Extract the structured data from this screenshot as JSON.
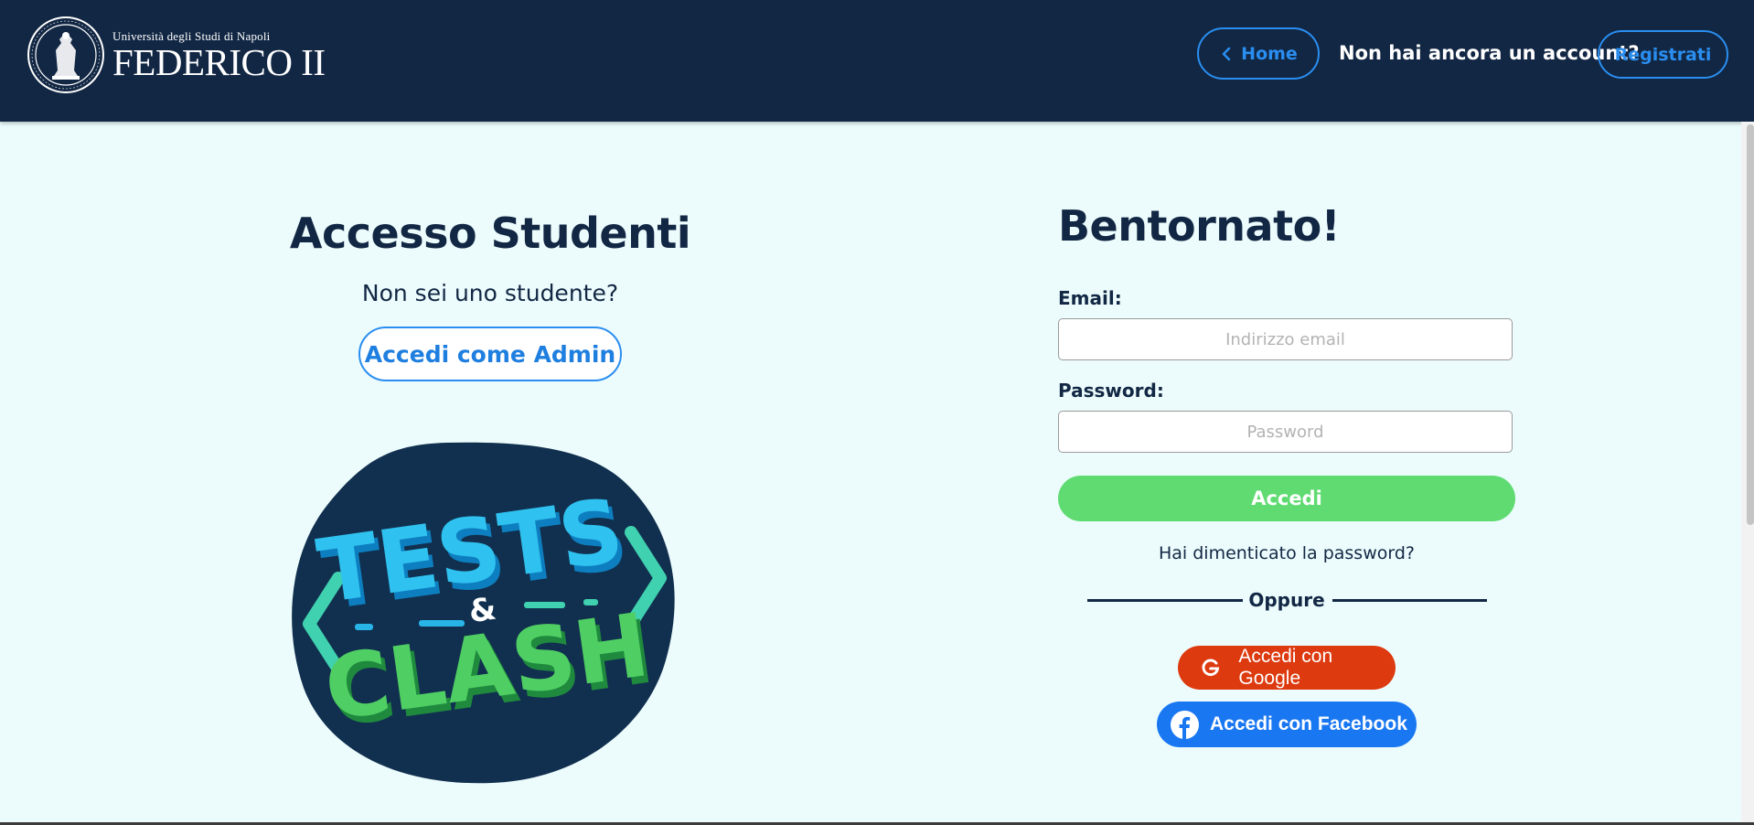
{
  "header": {
    "logo": {
      "line1": "Università degli Studi di Napoli",
      "line2": "FEDERICO II"
    },
    "home_label": "Home",
    "no_account_text": "Non hai ancora un account?",
    "register_label": "Registrati"
  },
  "left": {
    "title": "Accesso Studenti",
    "not_student_text": "Non sei uno studente?",
    "admin_button": "Accedi come Admin",
    "game_logo": {
      "word1": "TESTS",
      "amp": "&",
      "word2": "CLASH"
    }
  },
  "right": {
    "title": "Bentornato!",
    "email_label": "Email:",
    "email_placeholder": "Indirizzo email",
    "email_value": "",
    "password_label": "Password:",
    "password_placeholder": "Password",
    "password_value": "",
    "login_button": "Accedi",
    "forgot_password": "Hai dimenticato la password?",
    "or_text": "Oppure",
    "google_button": "Accedi con Google",
    "facebook_button": "Accedi con Facebook"
  },
  "colors": {
    "header_bg": "#122744",
    "page_bg": "#ecfcfc",
    "accent_blue": "#2a8ef0",
    "login_green": "#5fdb72",
    "google_red": "#dd3a0f",
    "facebook_blue": "#1977f2"
  },
  "icons": [
    "university-seal-icon",
    "chevron-left-icon",
    "google-g-icon",
    "facebook-f-icon"
  ]
}
